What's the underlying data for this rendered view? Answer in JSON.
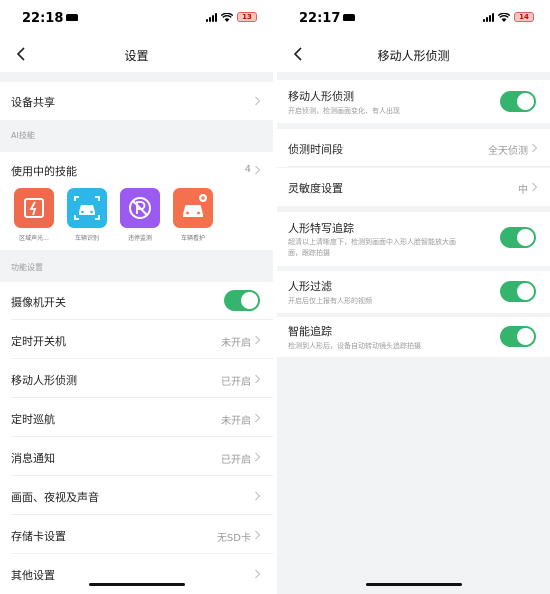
{
  "left": {
    "status": {
      "time": "22:18",
      "battery": "13"
    },
    "title": "设置",
    "device_share": "设备共享",
    "ai_header": "AI技能",
    "skills_in_use": {
      "label": "使用中的技能",
      "count": "4"
    },
    "skills": [
      {
        "label": "区域声光...",
        "color": "#f06a4d"
      },
      {
        "label": "车辆识别",
        "color": "#2cb7e8"
      },
      {
        "label": "违停监测",
        "color": "#9b5bf0"
      },
      {
        "label": "车辆看护",
        "color": "#f5704c"
      }
    ],
    "func_header": "功能设置",
    "rows": [
      {
        "label": "摄像机开关",
        "value": ""
      },
      {
        "label": "定时开关机",
        "value": "未开启"
      },
      {
        "label": "移动人形侦测",
        "value": "已开启"
      },
      {
        "label": "定时巡航",
        "value": "未开启"
      },
      {
        "label": "消息通知",
        "value": "已开启"
      },
      {
        "label": "画面、夜视及声音",
        "value": ""
      },
      {
        "label": "存储卡设置",
        "value": "无SD卡"
      },
      {
        "label": "其他设置",
        "value": ""
      }
    ]
  },
  "right": {
    "status": {
      "time": "22:17",
      "battery": "14"
    },
    "title": "移动人形侦测",
    "motion": {
      "label": "移动人形侦测",
      "desc": "开启侦测，检测画面变化、有人出现"
    },
    "period": {
      "label": "侦测时间段",
      "value": "全天侦测"
    },
    "sensitivity": {
      "label": "灵敏度设置",
      "value": "中"
    },
    "closeup": {
      "label": "人形特写追踪",
      "desc1": "超清以上清晰度下，检测到画面中入形人脸智能放大画",
      "desc2": "面，跟踪拍摄"
    },
    "filter": {
      "label": "人形过滤",
      "desc": "开启后仅上报有人形的视频"
    },
    "smart": {
      "label": "智能追踪",
      "desc": "检测到人形后，设备自动转动镜头追踪拍摄"
    }
  },
  "colors": {
    "toggle_on": "#35b46e",
    "background": "#f2f3f5"
  }
}
